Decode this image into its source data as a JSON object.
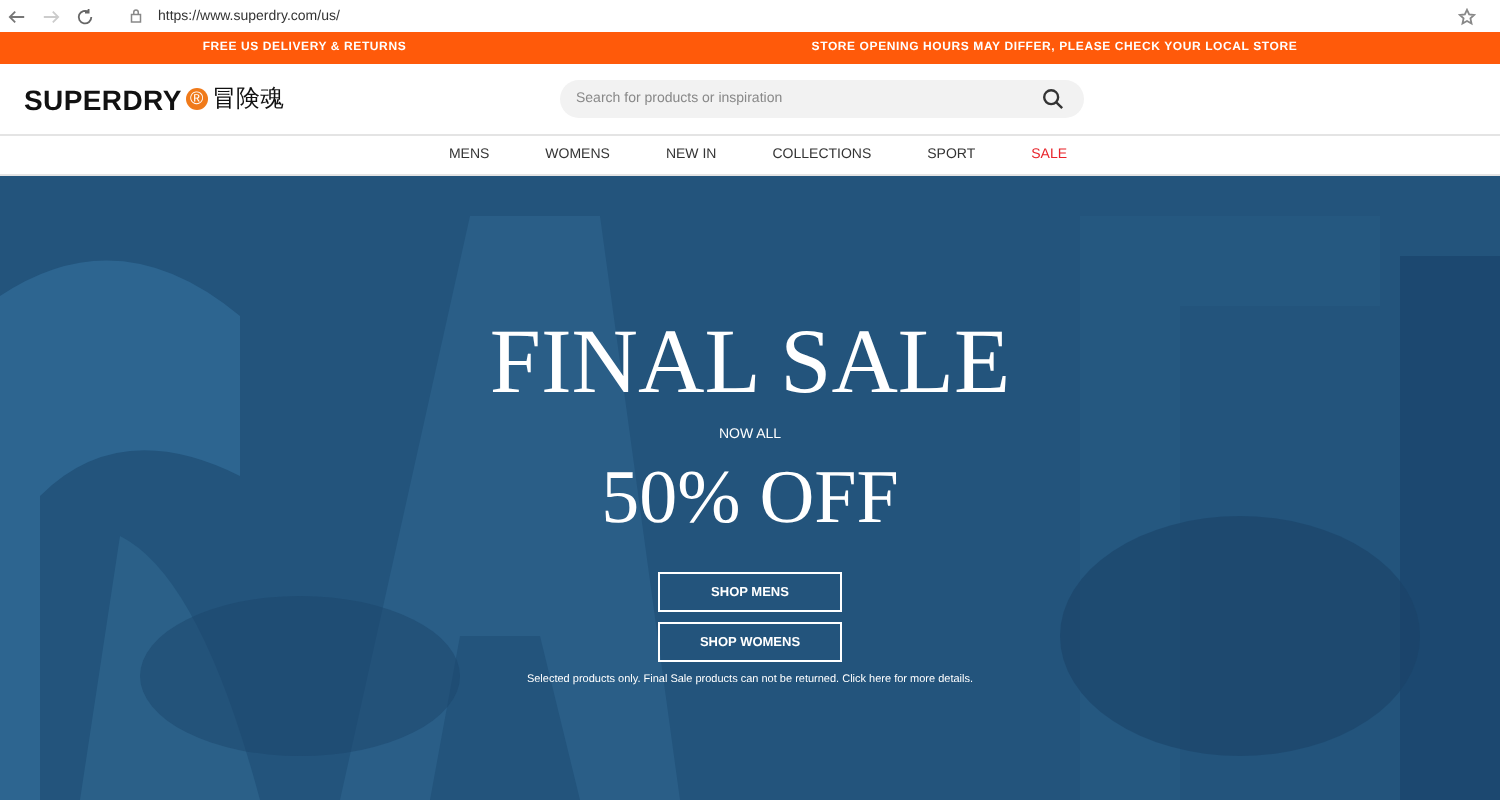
{
  "browser": {
    "url": "https://www.superdry.com/us/"
  },
  "promo_bar": [
    "FREE US DELIVERY & RETURNS",
    "STORE OPENING HOURS MAY DIFFER, PLEASE CHECK YOUR LOCAL STORE"
  ],
  "logo": {
    "name": "SUPERDRY",
    "mark": "®",
    "tagline": "冒険魂"
  },
  "search": {
    "placeholder": "Search for products or inspiration"
  },
  "nav": [
    {
      "label": "MENS",
      "highlighted": false
    },
    {
      "label": "WOMENS",
      "highlighted": false
    },
    {
      "label": "NEW IN",
      "highlighted": false
    },
    {
      "label": "COLLECTIONS",
      "highlighted": false
    },
    {
      "label": "SPORT",
      "highlighted": false
    },
    {
      "label": "SALE",
      "highlighted": true
    }
  ],
  "hero": {
    "kind": "picture",
    "title": "FINAL SALE",
    "subtitle": "NOW ALL",
    "offer": "50% OFF",
    "buttons": [
      "SHOP MENS",
      "SHOP WOMENS"
    ],
    "note": "Selected products only. Final Sale products can not be returned. Click here for more details."
  }
}
